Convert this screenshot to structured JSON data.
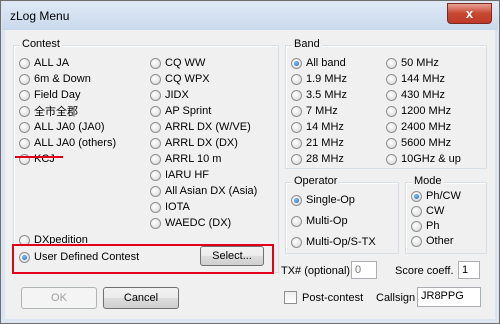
{
  "window": {
    "title": "zLog Menu",
    "close_glyph": "x"
  },
  "contest": {
    "label": "Contest",
    "col1": [
      "ALL JA",
      "6m & Down",
      "Field Day",
      "全市全郡",
      "ALL JA0 (JA0)",
      "ALL JA0 (others)",
      "KCJ"
    ],
    "col2": [
      "CQ WW",
      "CQ WPX",
      "JIDX",
      "AP Sprint",
      "ARRL DX (W/VE)",
      "ARRL DX (DX)",
      "ARRL 10 m",
      "IARU HF",
      "All Asian DX (Asia)",
      "IOTA",
      "WAEDC (DX)"
    ],
    "dxpedition": "DXpedition",
    "user_defined": "User Defined Contest",
    "select_button": "Select..."
  },
  "band": {
    "label": "Band",
    "col1": [
      "All band",
      "1.9 MHz",
      "3.5 MHz",
      "7 MHz",
      "14 MHz",
      "21 MHz",
      "28 MHz"
    ],
    "col2": [
      "50 MHz",
      "144 MHz",
      "430 MHz",
      "1200 MHz",
      "2400 MHz",
      "5600 MHz",
      "10GHz & up"
    ]
  },
  "operator": {
    "label": "Operator",
    "options": [
      "Single-Op",
      "Multi-Op",
      "Multi-Op/S-TX"
    ]
  },
  "mode": {
    "label": "Mode",
    "options": [
      "Ph/CW",
      "CW",
      "Ph",
      "Other"
    ]
  },
  "fields": {
    "tx_label": "TX# (optional)",
    "tx_value": "0",
    "score_label": "Score coeff.",
    "score_value": "1",
    "postcontest_label": "Post-contest",
    "callsign_label": "Callsign",
    "callsign_value": "JR8PPG"
  },
  "buttons": {
    "ok": "OK",
    "cancel": "Cancel"
  },
  "colors": {
    "annotation_red": "#e3001b",
    "selected_radio": "#1f5fa8"
  }
}
